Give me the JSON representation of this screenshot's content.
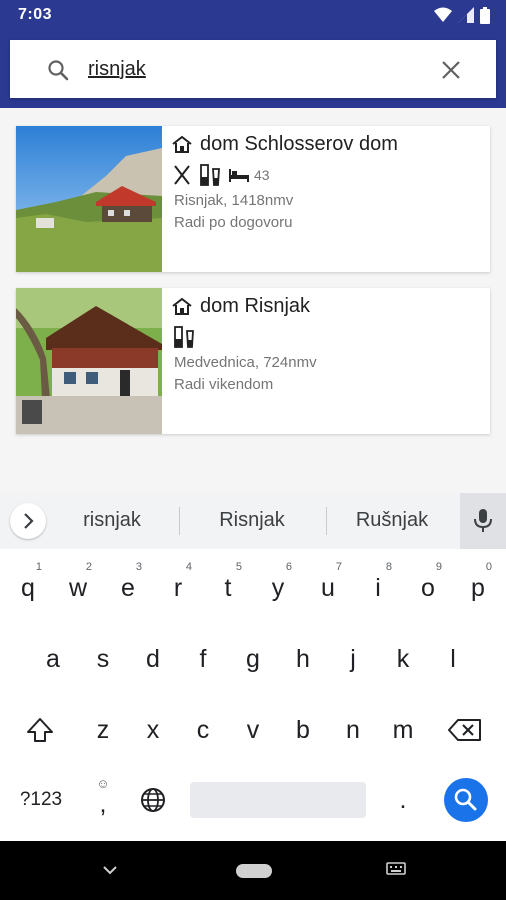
{
  "status_bar": {
    "time": "7:03"
  },
  "search": {
    "value": "risnjak"
  },
  "results": [
    {
      "title": "dom Schlosserov dom",
      "type_icon": "mountain-hut-icon",
      "amenities": [
        "food-icon",
        "drinks-icon",
        "bed-icon"
      ],
      "beds": "43",
      "location": "Risnjak, 1418nmv",
      "hours": "Radi po dogovoru"
    },
    {
      "title": "dom Risnjak",
      "type_icon": "mountain-hut-icon",
      "amenities": [
        "drinks-icon"
      ],
      "location": "Medvednica, 724nmv",
      "hours": "Radi vikendom"
    }
  ],
  "keyboard": {
    "suggestions": [
      "risnjak",
      "Risnjak",
      "Rušnjak"
    ],
    "row1": [
      [
        "q",
        "1"
      ],
      [
        "w",
        "2"
      ],
      [
        "e",
        "3"
      ],
      [
        "r",
        "4"
      ],
      [
        "t",
        "5"
      ],
      [
        "y",
        "6"
      ],
      [
        "u",
        "7"
      ],
      [
        "i",
        "8"
      ],
      [
        "o",
        "9"
      ],
      [
        "p",
        "0"
      ]
    ],
    "row2": [
      "a",
      "s",
      "d",
      "f",
      "g",
      "h",
      "j",
      "k",
      "l"
    ],
    "row3": [
      "z",
      "x",
      "c",
      "v",
      "b",
      "n",
      "m"
    ],
    "symbols_key": "?123",
    "comma_key": ",",
    "period_key": "."
  },
  "colors": {
    "app_bar": "#2b3990",
    "accent": "#1a73e8"
  }
}
